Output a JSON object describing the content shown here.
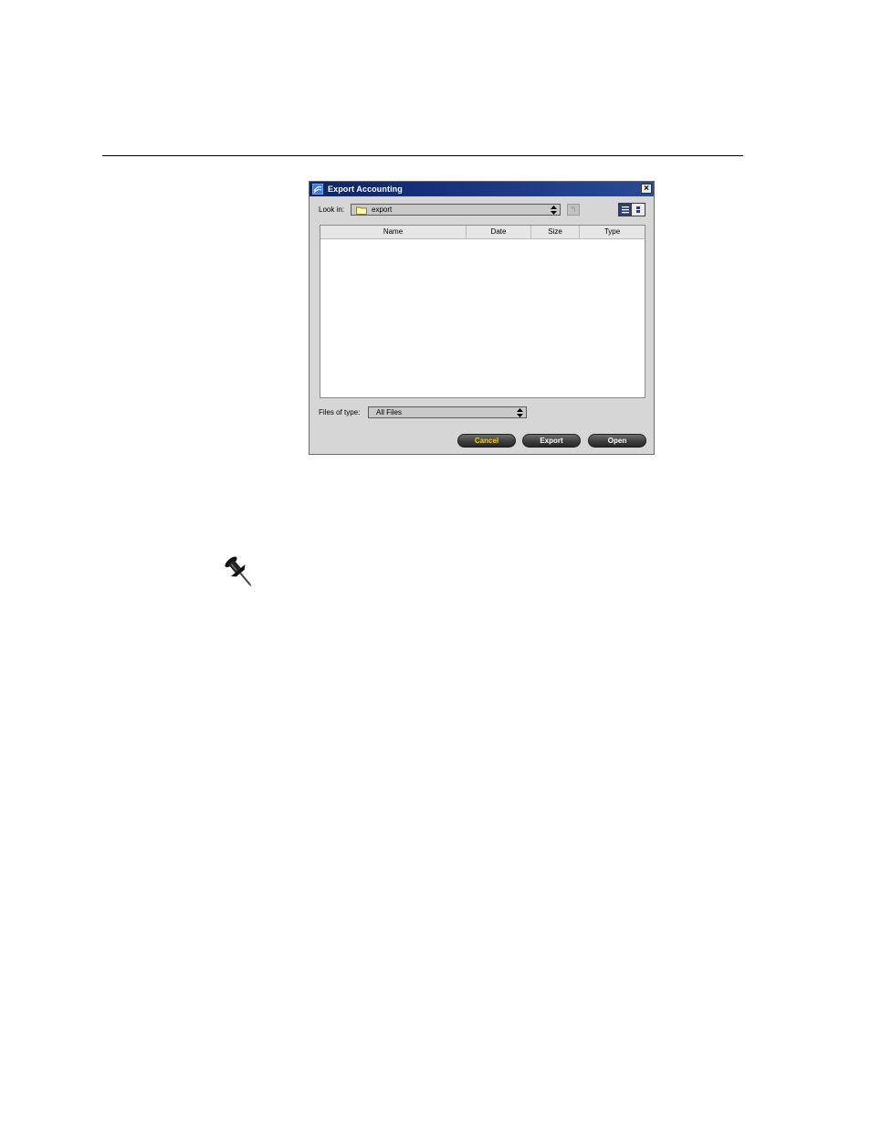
{
  "dialog": {
    "title": "Export Accounting",
    "look_in_label": "Look in:",
    "look_in_value": "export",
    "columns": [
      "Name",
      "Date",
      "Size",
      "Type"
    ],
    "files_of_type_label": "Files of type:",
    "files_of_type_value": "All Files",
    "buttons": {
      "cancel": "Cancel",
      "export": "Export",
      "open": "Open"
    },
    "accent_cancel": "#ffd200"
  },
  "icons": {
    "app": "app-logo-icon",
    "close": "close-icon",
    "folder": "folder-icon",
    "up": "up-folder-icon",
    "view_list": "list-view-icon",
    "view_details": "details-view-icon",
    "note": "pushpin-icon"
  }
}
